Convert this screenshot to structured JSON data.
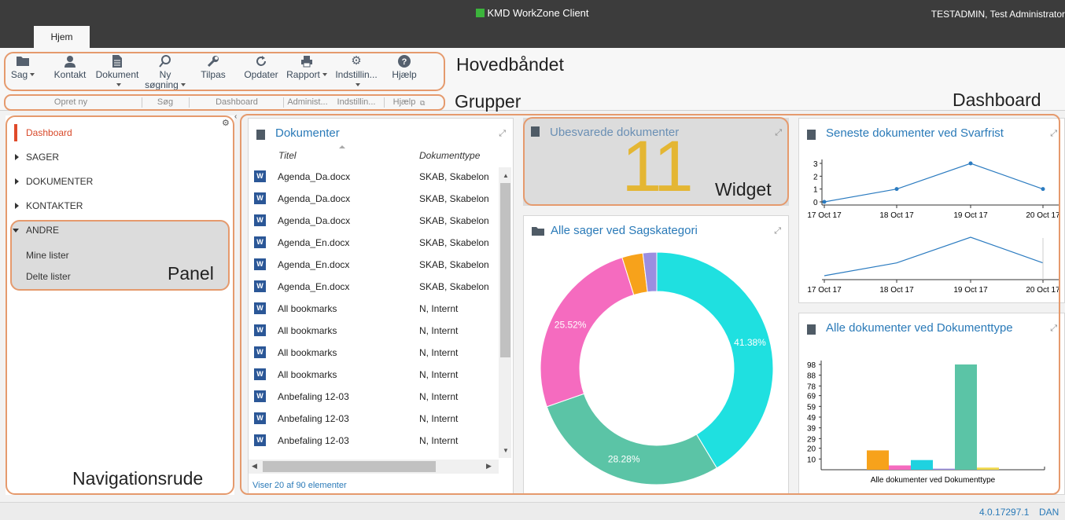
{
  "app": {
    "title": "KMD WorkZone Client",
    "user": "TESTADMIN, Test Administrator"
  },
  "tabs": [
    {
      "label": "Hjem"
    }
  ],
  "ribbon": {
    "buttons": [
      {
        "label": "Sag",
        "icon": "folder-icon"
      },
      {
        "label": "Kontakt",
        "icon": "user-icon"
      },
      {
        "label": "Dokument",
        "icon": "document-icon"
      },
      {
        "label": "Ny\nsøgning",
        "icon": "search-plus-icon"
      },
      {
        "label": "Tilpas",
        "icon": "wrench-icon"
      },
      {
        "label": "Opdater",
        "icon": "refresh-icon"
      },
      {
        "label": "Rapport",
        "icon": "printer-icon"
      },
      {
        "label": "Indstillin...",
        "icon": "gear-icon"
      },
      {
        "label": "Hjælp",
        "icon": "help-icon"
      }
    ],
    "groups": [
      "Opret ny",
      "Søg",
      "Dashboard",
      "Administ...",
      "Indstillin...",
      "Hjælp"
    ]
  },
  "annotations": {
    "ribbon": "Hovedbåndet",
    "groups": "Grupper",
    "dashboard": "Dashboard",
    "widget": "Widget",
    "panel": "Panel",
    "nav": "Navigationsrude"
  },
  "nav": {
    "items": [
      {
        "label": "Dashboard"
      },
      {
        "label": "SAGER"
      },
      {
        "label": "DOKUMENTER"
      },
      {
        "label": "KONTAKTER"
      },
      {
        "label": "ANDRE"
      }
    ],
    "sub_items": [
      {
        "label": "Mine lister"
      },
      {
        "label": "Delte lister"
      }
    ]
  },
  "widgets": {
    "documents": {
      "title": "Dokumenter",
      "col_title": "Titel",
      "col_type": "Dokumenttype",
      "footer": "Viser 20 af 90 elementer",
      "rows": [
        {
          "title": "Agenda_Da.docx",
          "type": "SKAB, Skabelon"
        },
        {
          "title": "Agenda_Da.docx",
          "type": "SKAB, Skabelon"
        },
        {
          "title": "Agenda_Da.docx",
          "type": "SKAB, Skabelon"
        },
        {
          "title": "Agenda_En.docx",
          "type": "SKAB, Skabelon"
        },
        {
          "title": "Agenda_En.docx",
          "type": "SKAB, Skabelon"
        },
        {
          "title": "Agenda_En.docx",
          "type": "SKAB, Skabelon"
        },
        {
          "title": "All bookmarks",
          "type": "N, Internt"
        },
        {
          "title": "All bookmarks",
          "type": "N, Internt"
        },
        {
          "title": "All bookmarks",
          "type": "N, Internt"
        },
        {
          "title": "All bookmarks",
          "type": "N, Internt"
        },
        {
          "title": "Anbefaling 12-03",
          "type": "N, Internt"
        },
        {
          "title": "Anbefaling 12-03",
          "type": "N, Internt"
        },
        {
          "title": "Anbefaling 12-03",
          "type": "N, Internt"
        }
      ]
    },
    "unanswered": {
      "title": "Ubesvarede dokumenter",
      "value": "11"
    },
    "cases": {
      "title": "Alle sager ved Sagskategori"
    },
    "deadline": {
      "title": "Seneste dokumenter ved Svarfrist"
    },
    "doctype": {
      "title": "Alle dokumenter ved Dokumenttype"
    }
  },
  "status": {
    "version": "4.0.17297.1",
    "lang": "DAN"
  },
  "chart_data": [
    {
      "type": "pie",
      "title": "Alle sager ved Sagskategori",
      "colors": [
        "#1fe0e0",
        "#5bc4a6",
        "#f56bbf",
        "#f7a21b",
        "#9b8ee0"
      ],
      "values": [
        41.38,
        28.28,
        25.52,
        2.9,
        1.92
      ],
      "labels": [
        "41.38%",
        "28.28%",
        "25.52%",
        "",
        ""
      ]
    },
    {
      "type": "line",
      "title": "Seneste dokumenter ved Svarfrist",
      "x": [
        "17 Oct 17",
        "18 Oct 17",
        "19 Oct 17",
        "20 Oct 17"
      ],
      "y": [
        0,
        1,
        3,
        1
      ],
      "yticks": [
        "0",
        "1",
        "2",
        "3"
      ],
      "color": "#2b7bc0"
    },
    {
      "type": "line",
      "x": [
        "17 Oct 17",
        "18 Oct 17",
        "19 Oct 17",
        "20 Oct 17"
      ],
      "y": [
        0,
        1,
        3,
        1
      ],
      "color": "#2b7bc0"
    },
    {
      "type": "bar",
      "title": "Alle dokumenter ved Dokumenttype",
      "xlabel": "Alle dokumenter ved Dokumenttype",
      "yticks": [
        "10",
        "20",
        "29",
        "39",
        "49",
        "59",
        "69",
        "78",
        "88",
        "98"
      ],
      "values": [
        18,
        4,
        9,
        1,
        98,
        2
      ],
      "colors": [
        "#f7a21b",
        "#f56bbf",
        "#1fd2e0",
        "#9b8ee0",
        "#5bc4a6",
        "#f0d84a"
      ]
    }
  ]
}
